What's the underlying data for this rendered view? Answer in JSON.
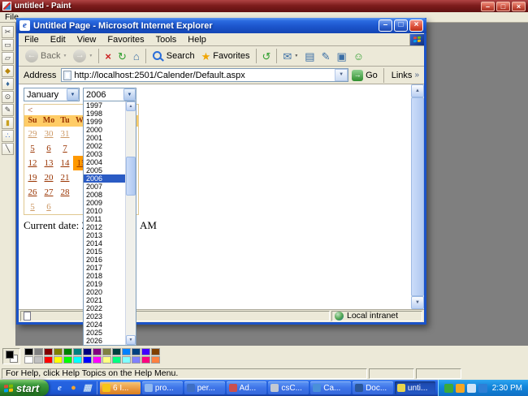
{
  "icons": {
    "minimize": "–",
    "maximize": "□",
    "close": "×",
    "dropdown_arrow": "▼",
    "scroll_up": "▲",
    "scroll_down": "▼",
    "links_chevron": "»",
    "go_arrow": "→",
    "ie_logo": "e"
  },
  "paint": {
    "title": "untitled - Paint",
    "menu": [
      "File"
    ],
    "status_text": "For Help, click Help Topics on the Help Menu.",
    "fg_color": "#000000",
    "bg_color": "#FFFFFF",
    "tools": [
      {
        "name": "free-form-select-tool",
        "glyph": "✂"
      },
      {
        "name": "select-tool",
        "glyph": "▭"
      },
      {
        "name": "eraser-tool",
        "glyph": "▱"
      },
      {
        "name": "fill-tool",
        "glyph": "◆",
        "color": "#b8860b"
      },
      {
        "name": "color-picker-tool",
        "glyph": "♦",
        "color": "#336699"
      },
      {
        "name": "magnifier-tool",
        "glyph": "⊙"
      },
      {
        "name": "pencil-tool",
        "glyph": "✎"
      },
      {
        "name": "brush-tool",
        "glyph": "▮",
        "color": "#c8a020"
      },
      {
        "name": "airbrush-tool",
        "glyph": "∴",
        "color": "#3366cc"
      },
      {
        "name": "line-tool",
        "glyph": "╲"
      }
    ],
    "palette_rows": [
      [
        "#000000",
        "#808080",
        "#800000",
        "#808000",
        "#008000",
        "#008080",
        "#000080",
        "#800080",
        "#808040",
        "#004040",
        "#0080FF",
        "#004080",
        "#4000FF",
        "#804000"
      ],
      [
        "#FFFFFF",
        "#C0C0C0",
        "#FF0000",
        "#FFFF00",
        "#00FF00",
        "#00FFFF",
        "#0000FF",
        "#FF00FF",
        "#FFFF80",
        "#00FF80",
        "#80FFFF",
        "#8080FF",
        "#FF0080",
        "#FF8040"
      ]
    ]
  },
  "ie": {
    "title": "Untitled Page - Microsoft Internet Explorer",
    "menus": [
      "File",
      "Edit",
      "View",
      "Favorites",
      "Tools",
      "Help"
    ],
    "toolbar_buttons": [
      {
        "name": "back",
        "glyph": "←",
        "label": "Back",
        "style": "circle",
        "dropdown": true,
        "disabled": true
      },
      {
        "name": "forward",
        "glyph": "→",
        "style": "circle",
        "dropdown": true,
        "disabled": true
      },
      {
        "sep": true
      },
      {
        "name": "stop",
        "glyph": "×",
        "style": "red"
      },
      {
        "name": "refresh",
        "glyph": "↻",
        "style": "grn"
      },
      {
        "name": "home",
        "glyph": "⌂",
        "style": "blu"
      },
      {
        "sep": true
      },
      {
        "name": "search",
        "label": "Search",
        "style": "mag"
      },
      {
        "name": "favorites",
        "glyph": "★",
        "label": "Favorites",
        "style": "org"
      },
      {
        "sep": true
      },
      {
        "name": "history",
        "glyph": "↺",
        "style": "grn"
      },
      {
        "sep": true
      },
      {
        "name": "mail",
        "glyph": "✉",
        "style": "blu",
        "dropdown": true
      },
      {
        "name": "print",
        "glyph": "▤",
        "style": "blu"
      },
      {
        "name": "edit",
        "glyph": "✎",
        "style": "blu"
      },
      {
        "name": "discuss",
        "glyph": "▣",
        "style": "blu"
      },
      {
        "name": "messenger",
        "glyph": "☺",
        "style": "grn"
      }
    ],
    "address": {
      "label": "Address",
      "url": "http://localhost:2501/Calender/Default.aspx",
      "go": "Go",
      "links": "Links"
    },
    "status_zone": "Local intranet"
  },
  "page": {
    "month_value": "January",
    "year_value": "2006",
    "year_selected": "2006",
    "year_options": [
      "1997",
      "1998",
      "1999",
      "2000",
      "2001",
      "2002",
      "2003",
      "2004",
      "2005",
      "2006",
      "2007",
      "2008",
      "2009",
      "2010",
      "2011",
      "2012",
      "2013",
      "2014",
      "2015",
      "2016",
      "2017",
      "2018",
      "2019",
      "2020",
      "2021",
      "2022",
      "2023",
      "2024",
      "2025",
      "2026"
    ],
    "calendar": {
      "nav_prev": "<",
      "day_headers": [
        "Su",
        "Mo",
        "Tu",
        "We"
      ],
      "rows": [
        {
          "cells": [
            "29",
            "30",
            "31"
          ],
          "muted": true
        },
        {
          "cells": [
            "5",
            "6",
            "7"
          ],
          "muted": false
        },
        {
          "cells": [
            "12",
            "13",
            "14"
          ],
          "muted": false,
          "selected_cell": "15"
        },
        {
          "cells": [
            "19",
            "20",
            "21"
          ],
          "muted": false
        },
        {
          "cells": [
            "26",
            "27",
            "28"
          ],
          "muted": false
        },
        {
          "cells": [
            "5",
            "6"
          ],
          "muted": true
        }
      ]
    },
    "current_date_prefix": "Current date: 2/15",
    "current_date_suffix": "AM"
  },
  "taskbar": {
    "start": "start",
    "quick_launch": [
      {
        "name": "ie-quick-launch-icon",
        "glyph": "e",
        "color": "#CFE4FB"
      },
      {
        "name": "browser-quick-launch-icon",
        "glyph": "●",
        "color": "#F5A52E"
      },
      {
        "name": "show-desktop-icon",
        "glyph": "▦",
        "color": "#BFD8F2"
      }
    ],
    "buttons": [
      {
        "label": "6 I...",
        "icon_color": "#F5C518",
        "state": "flashing"
      },
      {
        "label": "pro...",
        "icon_color": "#8FB8F0"
      },
      {
        "label": "per...",
        "icon_color": "#3E6FC4"
      },
      {
        "label": "Ad...",
        "icon_color": "#C94F4F"
      },
      {
        "label": "csC...",
        "icon_color": "#C2C8D2"
      },
      {
        "label": "Ca...",
        "icon_color": "#4A90D9"
      },
      {
        "label": "Doc...",
        "icon_color": "#2B579A"
      },
      {
        "label": "unti...",
        "icon_color": "#E8D44D",
        "state": "active"
      }
    ],
    "tray_icons": [
      {
        "name": "security-tray-icon",
        "color": "#3BAA3B"
      },
      {
        "name": "update-tray-icon",
        "color": "#F5A623"
      },
      {
        "name": "volume-tray-icon",
        "color": "#CFE4F7"
      },
      {
        "name": "network-tray-icon",
        "color": "#2E7FD6"
      }
    ],
    "time": "2:30 PM"
  }
}
